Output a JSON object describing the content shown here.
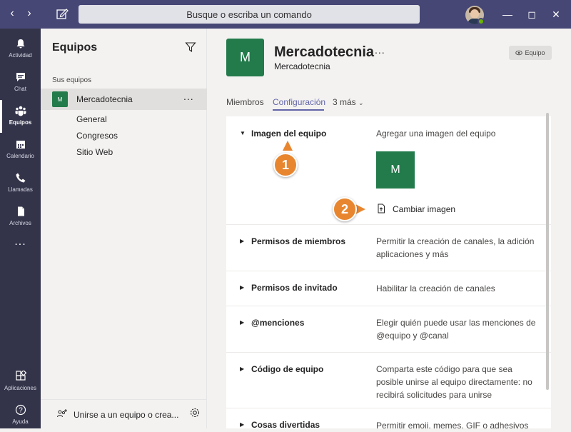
{
  "titlebar": {
    "search_placeholder": "Busque o escriba un comando"
  },
  "rail": {
    "items": [
      {
        "label": "Actividad",
        "icon": "bell-icon"
      },
      {
        "label": "Chat",
        "icon": "chat-icon"
      },
      {
        "label": "Equipos",
        "icon": "teams-icon",
        "active": true
      },
      {
        "label": "Calendario",
        "icon": "calendar-icon"
      },
      {
        "label": "Llamadas",
        "icon": "phone-icon"
      },
      {
        "label": "Archivos",
        "icon": "file-icon"
      }
    ],
    "more": "...",
    "bottom": [
      {
        "label": "Aplicaciones",
        "icon": "apps-icon"
      },
      {
        "label": "Ayuda",
        "icon": "help-icon"
      }
    ]
  },
  "teams_pane": {
    "title": "Equipos",
    "section_label": "Sus equipos",
    "team": {
      "badge": "M",
      "name": "Mercadotecnia",
      "more": "..."
    },
    "channels": [
      "General",
      "Congresos",
      "Sitio Web"
    ],
    "footer_join": "Unirse a un equipo o crea..."
  },
  "main": {
    "badge": "M",
    "title": "Mercadotecnia",
    "title_more": "...",
    "subtitle": "Mercadotecnia",
    "team_badge_label": "Equipo",
    "tabs": [
      {
        "label": "Miembros"
      },
      {
        "label": "Configuración",
        "active": true
      },
      {
        "label": "3 más"
      }
    ],
    "settings": [
      {
        "title": "Imagen del equipo",
        "desc": "Agregar una imagen del equipo",
        "expanded": true,
        "preview_badge": "M",
        "change_label": "Cambiar imagen"
      },
      {
        "title": "Permisos de miembros",
        "desc": "Permitir la creación de canales, la adición aplicaciones y más"
      },
      {
        "title": "Permisos de invitado",
        "desc": "Habilitar la creación de canales"
      },
      {
        "title": "@menciones",
        "desc": "Elegir quién puede usar las menciones de @equipo y @canal"
      },
      {
        "title": "Código de equipo",
        "desc": "Comparta este código para que sea posible unirse al equipo directamente: no recibirá solicitudes para unirse"
      },
      {
        "title": "Cosas divertidas",
        "desc": "Permitir emoji, memes, GIF o adhesivos"
      }
    ]
  },
  "callouts": [
    "1",
    "2"
  ],
  "colors": {
    "titlebar": "#464775",
    "rail": "#33344a",
    "accent": "#6264a7",
    "team_green": "#237b4b",
    "callout": "#e8862f"
  }
}
